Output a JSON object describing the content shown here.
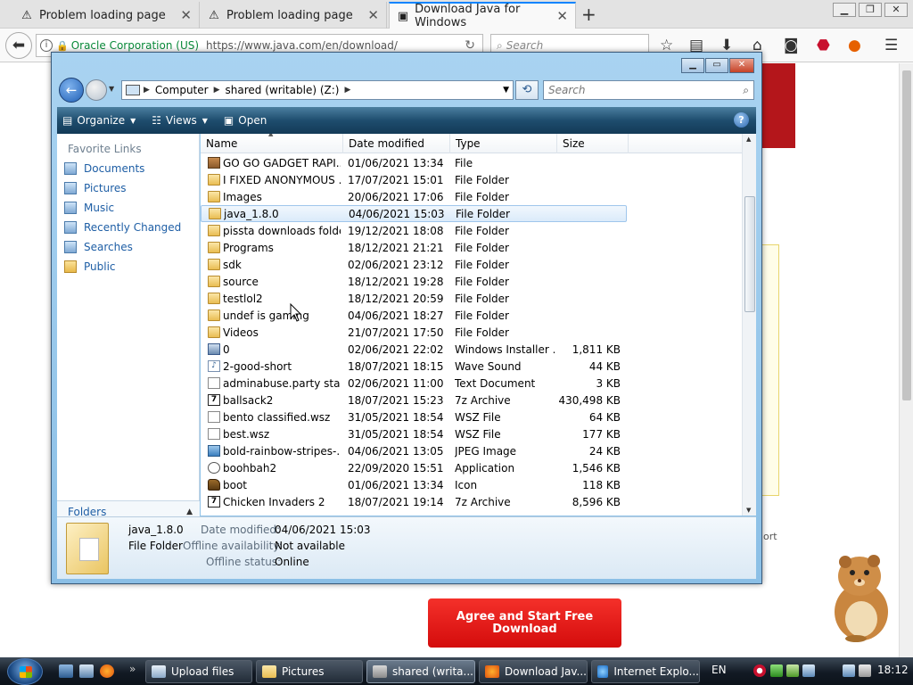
{
  "browser": {
    "tabs": [
      {
        "label": "Problem loading page",
        "icon": "warning-icon"
      },
      {
        "label": "Problem loading page",
        "icon": "warning-icon"
      },
      {
        "label": "Download Java for Windows",
        "icon": "page-icon"
      }
    ],
    "url_org": "Oracle Corporation (US)",
    "url": "https://www.java.com/en/download/",
    "search_placeholder": "Search"
  },
  "page": {
    "agree_button": "Agree and Start Free Download",
    "side_text": "ort"
  },
  "explorer": {
    "breadcrumb": [
      "Computer",
      "shared (writable) (Z:)"
    ],
    "search_placeholder": "Search",
    "commands": {
      "organize": "Organize",
      "views": "Views",
      "open": "Open"
    },
    "nav": {
      "header": "Favorite Links",
      "links": [
        "Documents",
        "Pictures",
        "Music",
        "Recently Changed",
        "Searches",
        "Public"
      ],
      "folders": "Folders"
    },
    "columns": {
      "name": "Name",
      "date": "Date modified",
      "type": "Type",
      "size": "Size"
    },
    "files": [
      {
        "name": "GO GO GADGET RAPI...",
        "date": "01/06/2021 13:34",
        "type": "File",
        "size": "",
        "icon": "box"
      },
      {
        "name": "I FIXED ANONYMOUS ...",
        "date": "17/07/2021 15:01",
        "type": "File Folder",
        "size": "",
        "icon": "folder"
      },
      {
        "name": "Images",
        "date": "20/06/2021 17:06",
        "type": "File Folder",
        "size": "",
        "icon": "folder"
      },
      {
        "name": "java_1.8.0",
        "date": "04/06/2021 15:03",
        "type": "File Folder",
        "size": "",
        "icon": "folder"
      },
      {
        "name": "pissta downloads folder",
        "date": "19/12/2021 18:08",
        "type": "File Folder",
        "size": "",
        "icon": "folder"
      },
      {
        "name": "Programs",
        "date": "18/12/2021 21:21",
        "type": "File Folder",
        "size": "",
        "icon": "folder"
      },
      {
        "name": "sdk",
        "date": "02/06/2021 23:12",
        "type": "File Folder",
        "size": "",
        "icon": "folder"
      },
      {
        "name": "source",
        "date": "18/12/2021 19:28",
        "type": "File Folder",
        "size": "",
        "icon": "folder"
      },
      {
        "name": "testlol2",
        "date": "18/12/2021 20:59",
        "type": "File Folder",
        "size": "",
        "icon": "folder"
      },
      {
        "name": "undef is gaming",
        "date": "04/06/2021 18:27",
        "type": "File Folder",
        "size": "",
        "icon": "folder"
      },
      {
        "name": "Videos",
        "date": "21/07/2021 17:50",
        "type": "File Folder",
        "size": "",
        "icon": "folder"
      },
      {
        "name": "0",
        "date": "02/06/2021 22:02",
        "type": "Windows Installer ...",
        "size": "1,811 KB",
        "icon": "msi"
      },
      {
        "name": "2-good-short",
        "date": "18/07/2021 18:15",
        "type": "Wave Sound",
        "size": "44 KB",
        "icon": "wav"
      },
      {
        "name": "adminabuse.party stan...",
        "date": "02/06/2021 11:00",
        "type": "Text Document",
        "size": "3 KB",
        "icon": "file"
      },
      {
        "name": "ballsack2",
        "date": "18/07/2021 15:23",
        "type": "7z Archive",
        "size": "430,498 KB",
        "icon": "7z"
      },
      {
        "name": "bento classified.wsz",
        "date": "31/05/2021 18:54",
        "type": "WSZ File",
        "size": "64 KB",
        "icon": "file"
      },
      {
        "name": "best.wsz",
        "date": "31/05/2021 18:54",
        "type": "WSZ File",
        "size": "177 KB",
        "icon": "file"
      },
      {
        "name": "bold-rainbow-stripes-...",
        "date": "04/06/2021 13:05",
        "type": "JPEG Image",
        "size": "24 KB",
        "icon": "jpg"
      },
      {
        "name": "boohbah2",
        "date": "22/09/2020 15:51",
        "type": "Application",
        "size": "1,546 KB",
        "icon": "app"
      },
      {
        "name": "boot",
        "date": "01/06/2021 13:34",
        "type": "Icon",
        "size": "118 KB",
        "icon": "boot"
      },
      {
        "name": "Chicken Invaders 2",
        "date": "18/07/2021 19:14",
        "type": "7z Archive",
        "size": "8,596 KB",
        "icon": "7z"
      }
    ],
    "selected_index": 3,
    "details": {
      "name": "java_1.8.0",
      "kind": "File Folder",
      "date_label": "Date modified:",
      "date_value": "04/06/2021 15:03",
      "offline_avail_label": "Offline availability:",
      "offline_avail_value": "Not available",
      "offline_status_label": "Offline status:",
      "offline_status_value": "Online"
    }
  },
  "taskbar": {
    "buttons": [
      "Upload files",
      "Pictures",
      "shared (writa...",
      "Download Jav...",
      "Internet Explo..."
    ],
    "active_index": 2,
    "language": "EN",
    "clock": "18:12"
  }
}
